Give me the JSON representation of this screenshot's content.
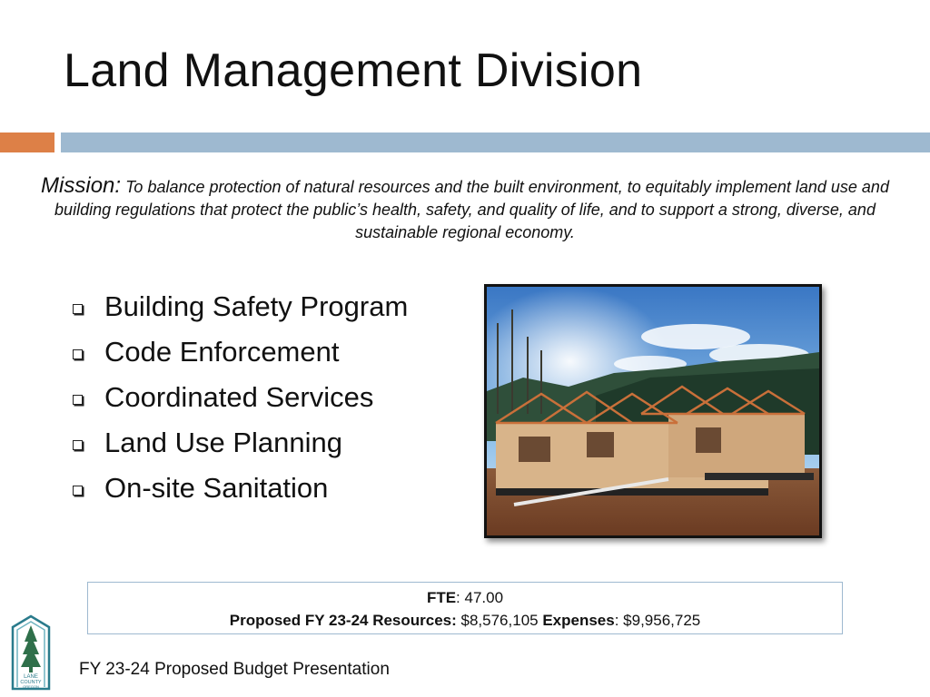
{
  "slide": {
    "title": "Land Management Division",
    "accent_colors": {
      "orange": "#dd8047",
      "blue": "#9eb9d0"
    }
  },
  "mission": {
    "label": "Mission:",
    "text": "To balance protection of natural resources and the built environment, to equitably implement land use and building regulations that protect the public’s health, safety, and quality of life, and to support a strong, diverse, and sustainable regional economy."
  },
  "programs": [
    "Building Safety Program",
    "Code Enforcement",
    "Coordinated Services",
    "Land Use Planning",
    "On-site Sanitation"
  ],
  "budget": {
    "fte_label": "FTE",
    "fte_value": ": 47.00",
    "resources_label": "Proposed FY 23-24 Resources:",
    "resources_value": " $8,576,105 ",
    "expenses_label": "Expenses",
    "expenses_value": ": $9,956,725"
  },
  "logo": {
    "line1": "LANE",
    "line2": "COUNTY",
    "line3": "OREGON"
  },
  "footer": "FY 23-24 Proposed Budget Presentation"
}
